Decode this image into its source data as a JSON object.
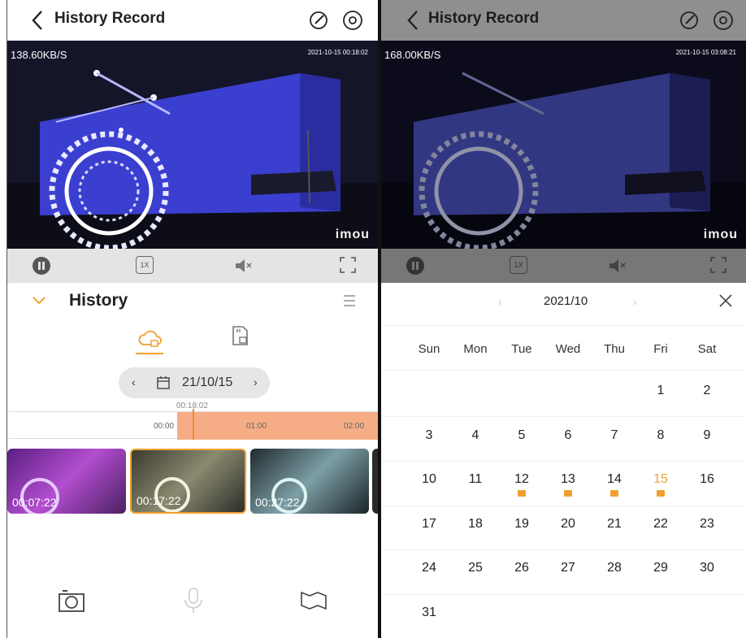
{
  "left": {
    "title": "History Record",
    "rate": "138.60KB/S",
    "timestamp": "2021-10-15 00:18:02",
    "brand": "imou",
    "speed": "1X",
    "history_label": "History",
    "date": "21/10/15",
    "cursor_time": "00:18:02",
    "ticks": [
      "00:00",
      "01:00",
      "02:00"
    ],
    "thumbs": [
      {
        "time": "00:07:22"
      },
      {
        "time": "00:17:22"
      },
      {
        "time": "00:27:22"
      }
    ]
  },
  "right": {
    "title": "History Record",
    "rate": "168.00KB/S",
    "timestamp": "2021-10-15 03:08:21",
    "brand": "imou",
    "speed": "1X",
    "calendar": {
      "month": "2021/10",
      "weekdays": [
        "Sun",
        "Mon",
        "Tue",
        "Wed",
        "Thu",
        "Fri",
        "Sat"
      ],
      "days": [
        "1",
        "2",
        "3",
        "4",
        "5",
        "6",
        "7",
        "8",
        "9",
        "10",
        "11",
        "12",
        "13",
        "14",
        "15",
        "16",
        "17",
        "18",
        "19",
        "20",
        "21",
        "22",
        "23",
        "24",
        "25",
        "26",
        "27",
        "28",
        "29",
        "30",
        "31"
      ],
      "recorded_days": [
        "12",
        "13",
        "14",
        "15"
      ],
      "selected_day": "15"
    }
  },
  "colors": {
    "accent": "#f0a030",
    "timeline_fill": "#f6ad86"
  }
}
